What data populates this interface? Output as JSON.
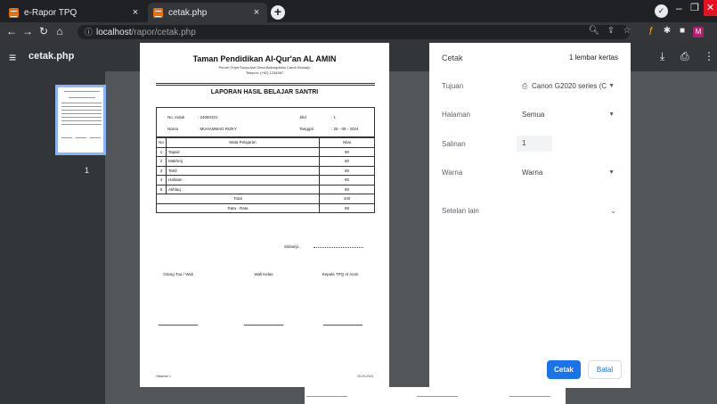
{
  "browser": {
    "tabs": [
      {
        "title": "e-Rapor TPQ",
        "close": "×"
      },
      {
        "title": "cetak.php",
        "close": "×"
      }
    ],
    "new_tab": "+",
    "profile_initial": "✓",
    "url_host": "localhost",
    "url_path": "/rapor/cetak.php",
    "info_icon": "ⓘ",
    "extension_m": "M"
  },
  "pdf_viewer": {
    "title": "cetak.php",
    "page_number": "1"
  },
  "document": {
    "school_name": "Taman Pendidikan Al-Qur'an AL AMIN",
    "address": "Perum Griya Surya Asri Desa Balongdowo Candi-Sidoarjo",
    "phone": "Telepon: (+62) 1234567",
    "report_title": "LAPORAN HASIL BELAJAR SANTRI",
    "info": {
      "no_induk_label": "No. Induk",
      "no_induk": ": 24080101",
      "nama_label": "Nama",
      "nama": ": MUHAMMAD RIZKY",
      "jilid_label": "Jilid",
      "jilid": ": 1",
      "tanggal_label": "Tanggal",
      "tanggal": ": 25 - 09 - 2024"
    },
    "table": {
      "headers": [
        "No",
        "Mata Pelajaran",
        "Nilai"
      ],
      "rows": [
        {
          "no": "1",
          "subject": "Tajwid",
          "score": "90"
        },
        {
          "no": "2",
          "subject": "Makhroj",
          "score": "90"
        },
        {
          "no": "3",
          "subject": "Tartil",
          "score": "90"
        },
        {
          "no": "4",
          "subject": "Hafalan",
          "score": "90"
        },
        {
          "no": "5",
          "subject": "Akhlaq",
          "score": "80"
        }
      ],
      "total_label": "Total",
      "total": "440",
      "average_label": "Rata - Rata",
      "average": "88"
    },
    "place": "Sidoarjo ,",
    "signatures": [
      "Orang Tua / Wali",
      "Wali Kelas",
      "Kepala TPQ Al Amin"
    ],
    "footer_left": "Halaman 1",
    "footer_right": "25-09-2024"
  },
  "print_panel": {
    "title": "Cetak",
    "sheets": "1 lembar kertas",
    "destination_label": "Tujuan",
    "destination_value": "Canon G2020 series (C",
    "pages_label": "Halaman",
    "pages_value": "Semua",
    "copies_label": "Salinan",
    "copies_value": "1",
    "color_label": "Warna",
    "color_value": "Warna",
    "more_settings": "Setelan lain",
    "print_button": "Cetak",
    "cancel_button": "Batal"
  }
}
